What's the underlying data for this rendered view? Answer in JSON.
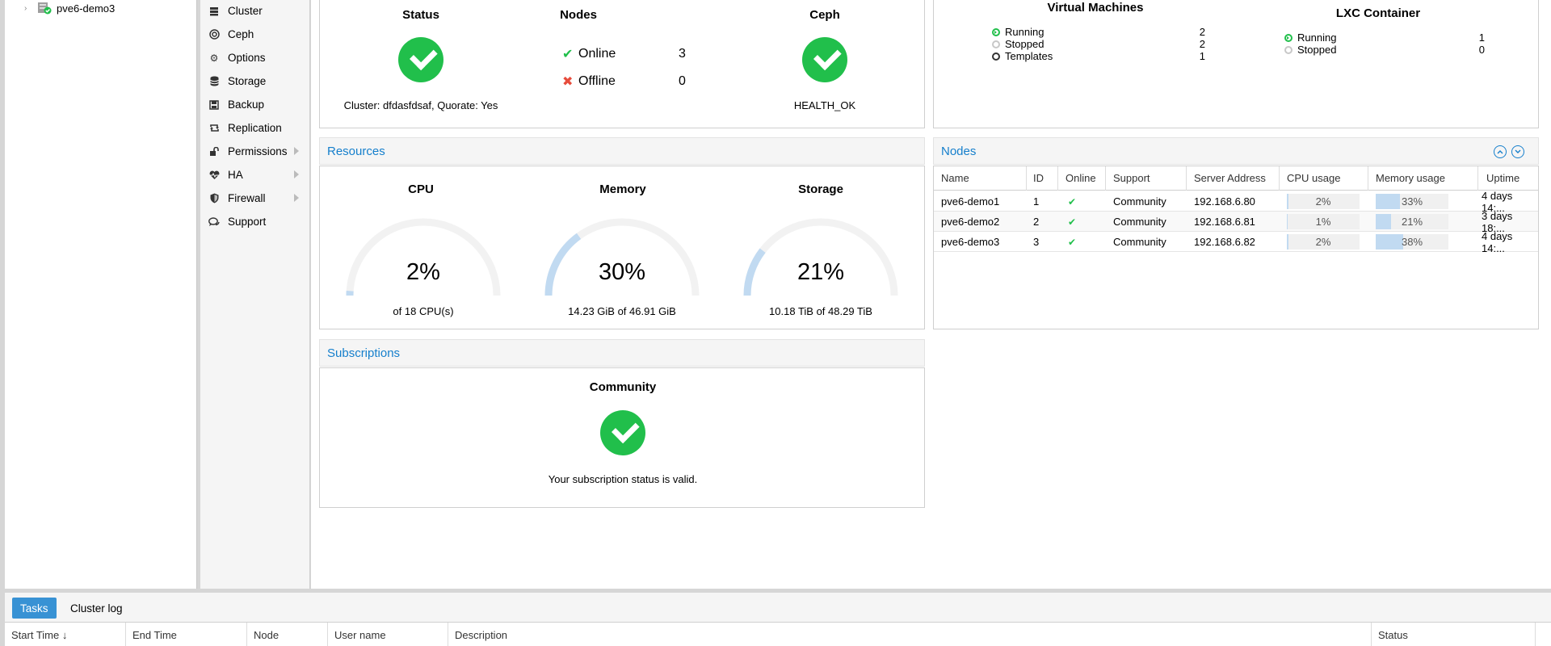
{
  "tree": {
    "node_label": "pve6-demo3"
  },
  "nav": {
    "items": [
      {
        "label": "Cluster",
        "icon": "server-stack-icon"
      },
      {
        "label": "Ceph",
        "icon": "ceph-icon"
      },
      {
        "label": "Options",
        "icon": "gear-icon"
      },
      {
        "label": "Storage",
        "icon": "database-icon"
      },
      {
        "label": "Backup",
        "icon": "floppy-icon"
      },
      {
        "label": "Replication",
        "icon": "retweet-icon"
      },
      {
        "label": "Permissions",
        "icon": "unlock-icon"
      },
      {
        "label": "HA",
        "icon": "heartbeat-icon"
      },
      {
        "label": "Firewall",
        "icon": "shield-icon"
      },
      {
        "label": "Support",
        "icon": "comments-icon"
      }
    ]
  },
  "health": {
    "status_title": "Status",
    "status_text": "Cluster: dfdasfdsaf, Quorate: Yes",
    "nodes_title": "Nodes",
    "online_label": "Online",
    "online_count": "3",
    "offline_label": "Offline",
    "offline_count": "0",
    "ceph_title": "Ceph",
    "ceph_text": "HEALTH_OK"
  },
  "guests": {
    "vm_title": "Virtual Machines",
    "vm_running_label": "Running",
    "vm_running": "2",
    "vm_stopped_label": "Stopped",
    "vm_stopped": "2",
    "vm_templates_label": "Templates",
    "vm_templates": "1",
    "lxc_title": "LXC Container",
    "lxc_running_label": "Running",
    "lxc_running": "1",
    "lxc_stopped_label": "Stopped",
    "lxc_stopped": "0"
  },
  "resources": {
    "header": "Resources",
    "cpu": {
      "title": "CPU",
      "value": "2%",
      "fraction": 0.02,
      "text": "of 18 CPU(s)"
    },
    "memory": {
      "title": "Memory",
      "value": "30%",
      "fraction": 0.3,
      "text": "14.23 GiB of 46.91 GiB"
    },
    "storage": {
      "title": "Storage",
      "value": "21%",
      "fraction": 0.21,
      "text": "10.18 TiB of 48.29 TiB"
    }
  },
  "subscriptions": {
    "header": "Subscriptions",
    "title": "Community",
    "text": "Your subscription status is valid."
  },
  "nodes_grid": {
    "header": "Nodes",
    "columns": [
      "Name",
      "ID",
      "Online",
      "Support",
      "Server Address",
      "CPU usage",
      "Memory usage",
      "Uptime"
    ],
    "rows": [
      {
        "name": "pve6-demo1",
        "id": "1",
        "support": "Community",
        "address": "192.168.6.80",
        "cpu": "2%",
        "cpu_frac": 0.02,
        "mem": "33%",
        "mem_frac": 0.33,
        "uptime": "4 days 14:..."
      },
      {
        "name": "pve6-demo2",
        "id": "2",
        "support": "Community",
        "address": "192.168.6.81",
        "cpu": "1%",
        "cpu_frac": 0.01,
        "mem": "21%",
        "mem_frac": 0.21,
        "uptime": "3 days 18:..."
      },
      {
        "name": "pve6-demo3",
        "id": "3",
        "support": "Community",
        "address": "192.168.6.82",
        "cpu": "2%",
        "cpu_frac": 0.02,
        "mem": "38%",
        "mem_frac": 0.38,
        "uptime": "4 days 14:..."
      }
    ]
  },
  "bottom": {
    "tab_tasks": "Tasks",
    "tab_log": "Cluster log",
    "columns": [
      "Start Time ↓",
      "End Time",
      "Node",
      "User name",
      "Description",
      "Status"
    ]
  },
  "colors": {
    "accent": "#157fcc",
    "ok": "#21bf4b",
    "error": "#e74c3c",
    "gauge_fill": "#c1daf1",
    "gauge_track": "#f2f2f2"
  }
}
